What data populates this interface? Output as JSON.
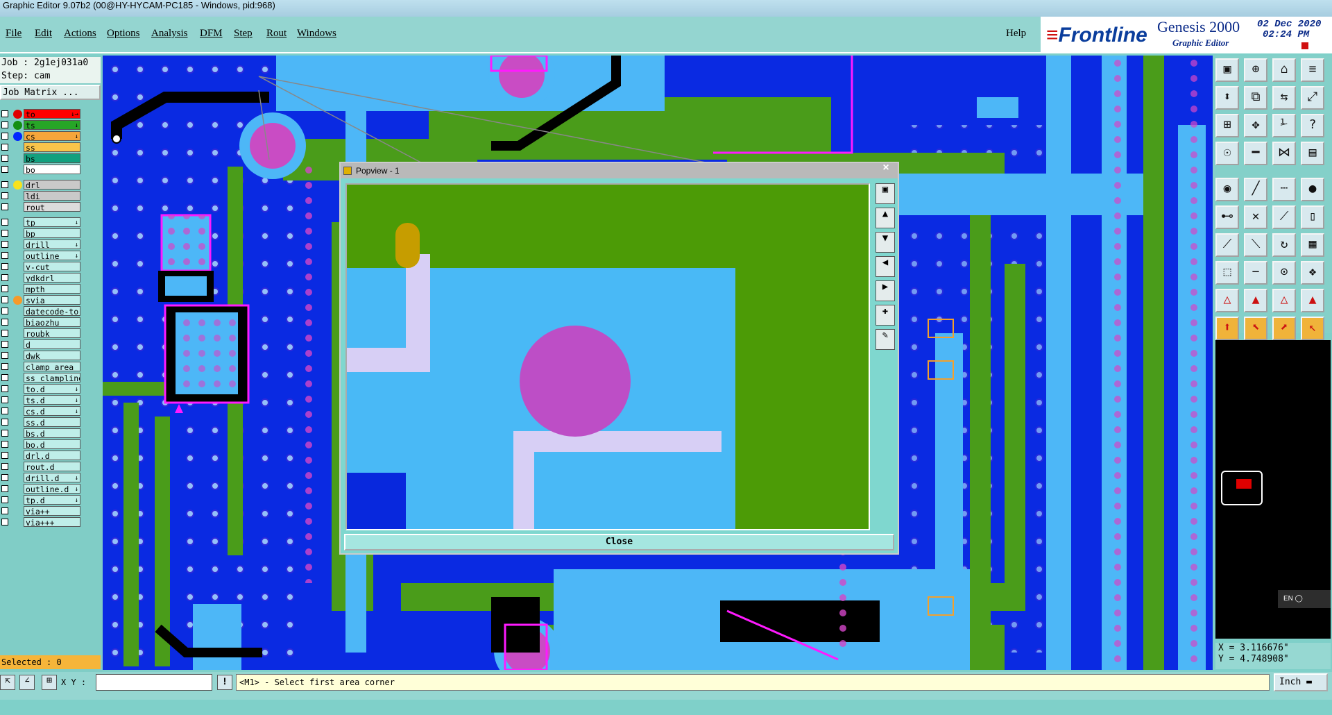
{
  "window": {
    "title": "Graphic Editor 9.07b2 (00@HY-HYCAM-PC185 - Windows, pid:968)"
  },
  "menu": {
    "items": [
      "File",
      "Edit",
      "Actions",
      "Options",
      "Analysis",
      "DFM",
      "Step",
      "Rout",
      "Windows"
    ],
    "help": "Help"
  },
  "brand": {
    "logo": "Frontline",
    "product": "Genesis 2000",
    "subtitle": "Graphic Editor",
    "date": "02 Dec 2020",
    "time": "02:24 PM"
  },
  "job": {
    "job_label": "Job : 2g1ej031a0",
    "step_label": "Step: cam",
    "matrix_button": "Job Matrix ..."
  },
  "layers": [
    {
      "name": "to",
      "color": "#ff0000",
      "dot": "#e00000",
      "arrow": "↓→"
    },
    {
      "name": "ts",
      "color": "#27a627",
      "dot": "#138f13",
      "arrow": "↓"
    },
    {
      "name": "cs",
      "color": "#f6a53a",
      "dot": "#0026ff",
      "arrow": "↓"
    },
    {
      "name": "ss",
      "color": "#f8c44a",
      "dot": "",
      "arrow": ""
    },
    {
      "name": "bs",
      "color": "#12a07e",
      "dot": "",
      "arrow": ""
    },
    {
      "name": "bo",
      "color": "#ffffff",
      "dot": "",
      "arrow": ""
    },
    {
      "name": "drl",
      "color": "#c9c9c9",
      "dot": "#f7e21d",
      "arrow": ""
    },
    {
      "name": "ldi",
      "color": "#c9c9c9",
      "dot": "",
      "arrow": ""
    },
    {
      "name": "rout",
      "color": "#dcdcdc",
      "dot": "",
      "arrow": ""
    },
    {
      "name": "tp",
      "color": "#bfeee9",
      "dot": "",
      "arrow": "↓"
    },
    {
      "name": "bp",
      "color": "#bfeee9",
      "dot": "",
      "arrow": ""
    },
    {
      "name": "drill",
      "color": "#bfeee9",
      "dot": "",
      "arrow": "↓"
    },
    {
      "name": "outline",
      "color": "#bfeee9",
      "dot": "",
      "arrow": "↓"
    },
    {
      "name": "v-cut",
      "color": "#bfeee9",
      "dot": "",
      "arrow": ""
    },
    {
      "name": "ydkdrl",
      "color": "#bfeee9",
      "dot": "",
      "arrow": ""
    },
    {
      "name": "mpth",
      "color": "#bfeee9",
      "dot": "",
      "arrow": ""
    },
    {
      "name": "svia",
      "color": "#bfeee9",
      "dot": "#f79a2a",
      "arrow": ""
    },
    {
      "name": "datecode-to",
      "color": "#bfeee9",
      "dot": "",
      "arrow": ""
    },
    {
      "name": "biaozhu",
      "color": "#bfeee9",
      "dot": "",
      "arrow": ""
    },
    {
      "name": "roubk",
      "color": "#bfeee9",
      "dot": "",
      "arrow": ""
    },
    {
      "name": "d",
      "color": "#bfeee9",
      "dot": "",
      "arrow": ""
    },
    {
      "name": "dwk",
      "color": "#bfeee9",
      "dot": "",
      "arrow": ""
    },
    {
      "name": "clamp_area",
      "color": "#bfeee9",
      "dot": "",
      "arrow": ""
    },
    {
      "name": "ss_clampline",
      "color": "#bfeee9",
      "dot": "",
      "arrow": ""
    },
    {
      "name": "to.d",
      "color": "#bfeee9",
      "dot": "",
      "arrow": "↓"
    },
    {
      "name": "ts.d",
      "color": "#bfeee9",
      "dot": "",
      "arrow": "↓"
    },
    {
      "name": "cs.d",
      "color": "#bfeee9",
      "dot": "",
      "arrow": "↓"
    },
    {
      "name": "ss.d",
      "color": "#bfeee9",
      "dot": "",
      "arrow": ""
    },
    {
      "name": "bs.d",
      "color": "#bfeee9",
      "dot": "",
      "arrow": ""
    },
    {
      "name": "bo.d",
      "color": "#bfeee9",
      "dot": "",
      "arrow": ""
    },
    {
      "name": "drl.d",
      "color": "#bfeee9",
      "dot": "",
      "arrow": ""
    },
    {
      "name": "rout.d",
      "color": "#bfeee9",
      "dot": "",
      "arrow": ""
    },
    {
      "name": "drill.d",
      "color": "#bfeee9",
      "dot": "",
      "arrow": "↓"
    },
    {
      "name": "outline.d",
      "color": "#bfeee9",
      "dot": "",
      "arrow": "↓"
    },
    {
      "name": "tp.d",
      "color": "#bfeee9",
      "dot": "",
      "arrow": "↓"
    },
    {
      "name": "via++",
      "color": "#bfeee9",
      "dot": "",
      "arrow": ""
    },
    {
      "name": "via+++",
      "color": "#bfeee9",
      "dot": "",
      "arrow": ""
    }
  ],
  "selected": "Selected : 0",
  "popup": {
    "title": "Popview - 1",
    "close": "Close"
  },
  "coordinates": {
    "x": "X = 3.116676\"",
    "y": "Y = 4.748908\""
  },
  "bottom": {
    "xy_label": "X Y :",
    "xy_value": "",
    "prompt": "<M1> - Select first area corner",
    "units": "Inch"
  },
  "ime": "EN"
}
